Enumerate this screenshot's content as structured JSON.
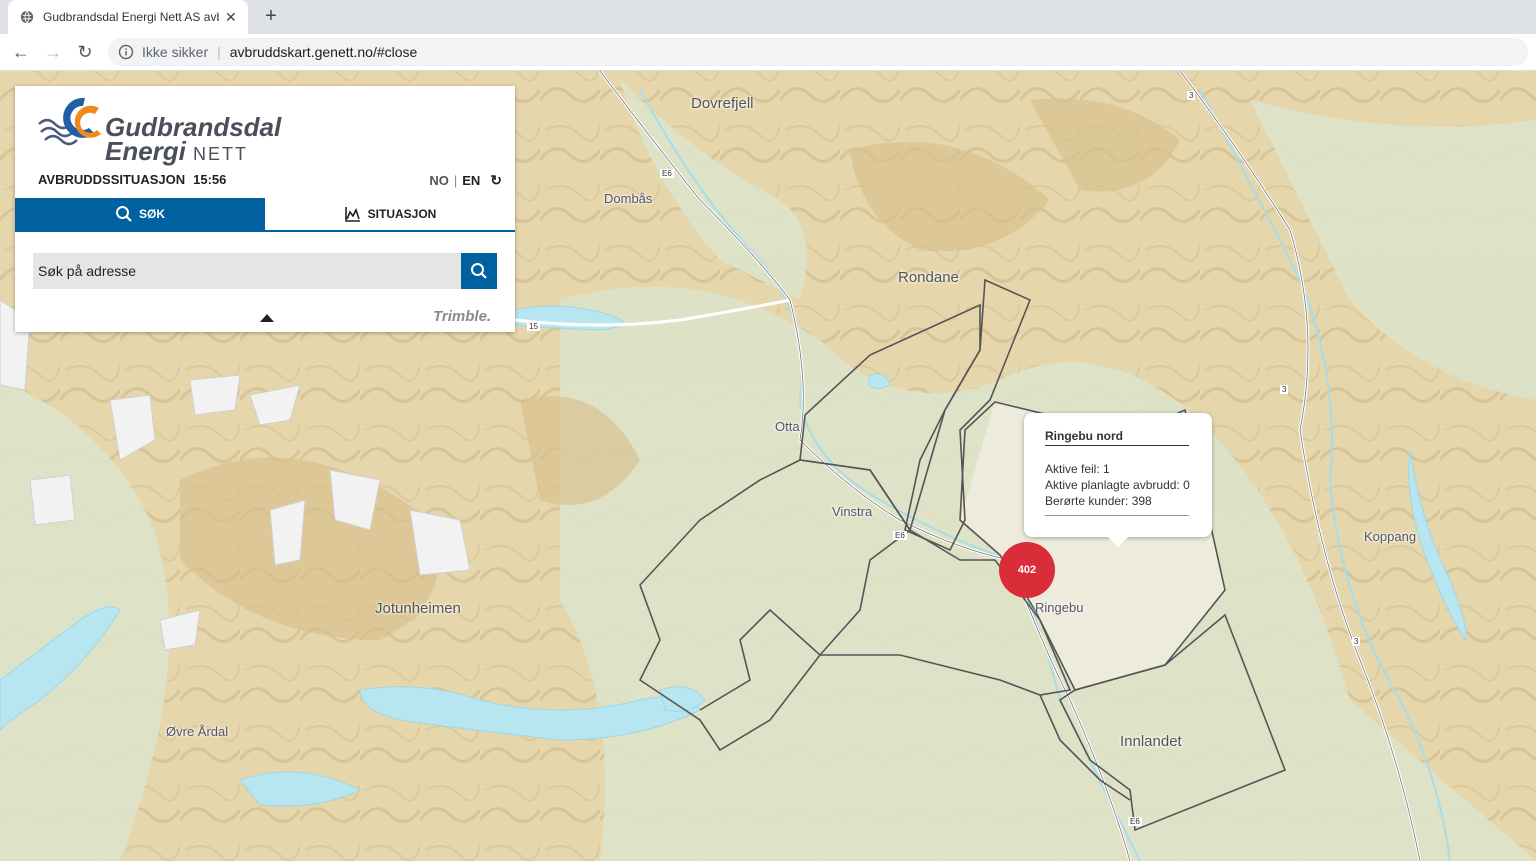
{
  "browser": {
    "tab_title": "Gudbrandsdal Energi Nett AS avbruddskart",
    "security_label": "Ikke sikker",
    "url": "avbruddskart.genett.no/#close"
  },
  "panel": {
    "logo_line1": "Gudbrandsdal",
    "logo_line2": "Energi",
    "logo_line3": "NETT",
    "status_label": "AVBRUDDSSITUASJON",
    "time": "15:56",
    "lang_no": "NO",
    "lang_sep": "|",
    "lang_en": "EN",
    "tab_search": "SØK",
    "tab_situation": "SITUASJON",
    "search_placeholder": "Søk på adresse",
    "trimble": "Trimble."
  },
  "map": {
    "places": {
      "dovrefjell": "Dovrefjell",
      "dombas": "Dombås",
      "rondane": "Rondane",
      "otta": "Otta",
      "vinstra": "Vinstra",
      "ringebu": "Ringebu",
      "jotunheimen": "Jotunheimen",
      "ovre_ardal": "Øvre Årdal",
      "innlandet": "Innlandet",
      "koppang": "Koppang"
    },
    "road_labels": {
      "e6_a": "E6",
      "e6_b": "E6",
      "e6_c": "E6",
      "r15": "15",
      "r3_a": "3",
      "r3_b": "3",
      "r3_c": "3"
    },
    "cluster_count": "402"
  },
  "popup": {
    "title": "Ringebu nord",
    "line1": "Aktive feil: 1",
    "line2": "Aktive planlagte avbrudd: 0",
    "line3": "Berørte kunder: 398"
  },
  "colors": {
    "brand_blue": "#0060a0",
    "cluster_red": "#d92d3a",
    "terrain_tan": "#e3d3a8",
    "valley_green": "#dfe6cf",
    "water": "#b8e6f0"
  }
}
